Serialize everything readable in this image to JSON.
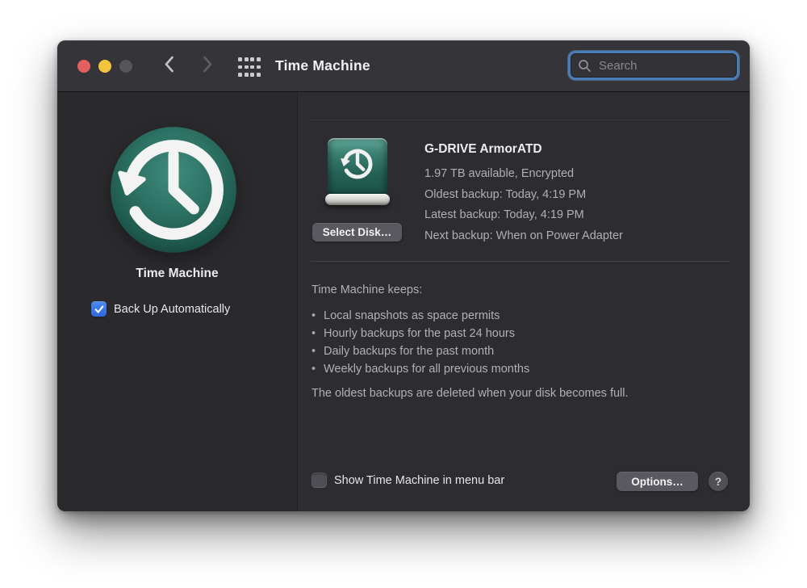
{
  "colors": {
    "traffic_red": "#e2605f",
    "traffic_yellow": "#f3c53f",
    "traffic_disabled": "#57555a",
    "accent_blue": "#2e66d9",
    "focus_ring": "#4a7cb6",
    "tm_green": "#2d7264",
    "titlebar_bg": "#353438",
    "sidebar_bg": "#2a292c",
    "content_bg": "#2d2c30"
  },
  "icons": {
    "search": "magnifier-icon",
    "back": "chevron-left-icon",
    "forward": "chevron-right-icon",
    "show_all": "app-grid-icon",
    "help": "question-mark-icon",
    "time_machine": "counterclockwise-clock-arrow-icon",
    "backup_disk": "teal-external-drive-icon"
  },
  "titlebar": {
    "title": "Time Machine",
    "search_placeholder": "Search"
  },
  "sidebar": {
    "app_label": "Time Machine",
    "auto_backup": {
      "label": "Back Up Automatically",
      "checked": true
    }
  },
  "content": {
    "disk": {
      "select_button": "Select Disk…",
      "name": "G-DRIVE ArmorATD",
      "details": [
        "1.97 TB available, Encrypted",
        "Oldest backup: Today, 4:19 PM",
        "Latest backup: Today, 4:19 PM",
        "Next backup: When on Power Adapter"
      ]
    },
    "keeps": {
      "heading": "Time Machine keeps:",
      "bullet": "•",
      "items": [
        "Local snapshots as space permits",
        "Hourly backups for the past 24 hours",
        "Daily backups for the past month",
        "Weekly backups for all previous months"
      ],
      "footnote": "The oldest backups are deleted when your disk becomes full."
    },
    "footer": {
      "menu_bar": {
        "label": "Show Time Machine in menu bar",
        "checked": false
      },
      "options_button": "Options…",
      "help_button": "?"
    }
  }
}
